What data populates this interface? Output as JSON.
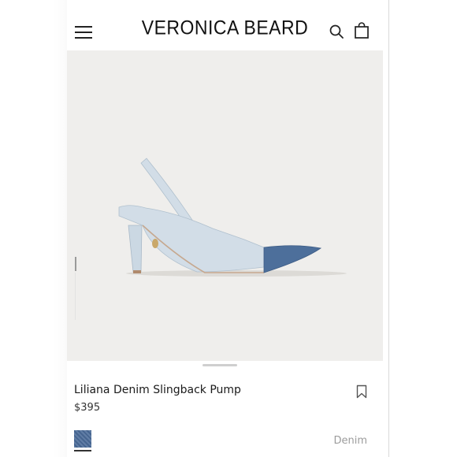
{
  "header": {
    "brand": "VERONICA BEARD",
    "menu_icon": "hamburger-menu-icon",
    "search_icon": "search-icon",
    "bag_icon": "shopping-bag-icon"
  },
  "product": {
    "name": "Liliana Denim Slingback Pump",
    "price": "$395",
    "color_label": "Denim",
    "swatch_color": "#4a6b99",
    "save_icon": "bookmark-icon"
  },
  "colors": {
    "text": "#1a1a1a",
    "image_bg": "#efeeec",
    "muted": "#9c9c9c"
  }
}
